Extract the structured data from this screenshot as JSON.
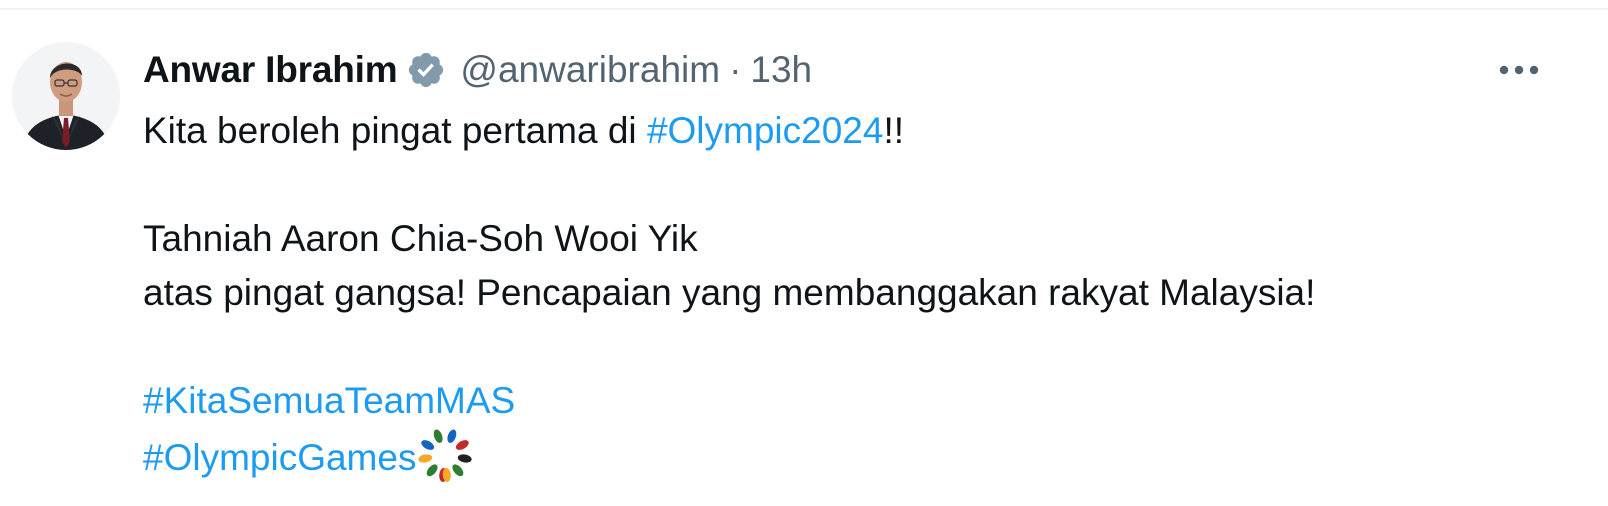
{
  "tweet": {
    "author": {
      "display_name": "Anwar Ibrahim",
      "handle": "@anwaribrahim",
      "verified": true,
      "avatar_icon": "profile-photo"
    },
    "separator": "·",
    "time": "13h",
    "more_icon": "more-horizontal-icon",
    "body": {
      "line1_text": "Kita beroleh pingat pertama di ",
      "line1_hashtag": "#Olympic2024",
      "line1_suffix": "!!",
      "line2": "Tahniah Aaron Chia-Soh Wooi Yik",
      "line3": "atas pingat gangsa! Pencapaian yang membanggakan rakyat Malaysia!",
      "hashtag1": "#KitaSemuaTeamMAS",
      "hashtag2": "#OlympicGames",
      "hashtag2_emoji": "olympic-laurel-icon"
    },
    "colors": {
      "text": "#0f1419",
      "secondary": "#536471",
      "link": "#1d9bf0",
      "verified": "#829aab"
    }
  }
}
